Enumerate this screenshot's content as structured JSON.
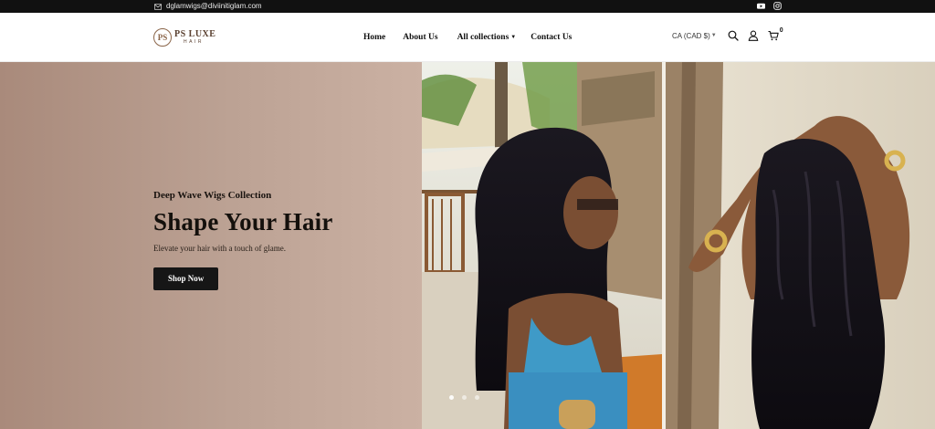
{
  "topbar": {
    "email": "dglamwigs@diviinitiglam.com",
    "social": [
      "youtube-icon",
      "instagram-icon"
    ]
  },
  "header": {
    "logo": {
      "mark": "PS",
      "brand": "PS LUXE",
      "sub": "HAIR"
    },
    "nav": [
      {
        "label": "Home"
      },
      {
        "label": "About Us"
      },
      {
        "label": "All collections",
        "has_dropdown": true
      },
      {
        "label": "Contact Us"
      }
    ],
    "currency": "CA (CAD $)",
    "cart_count": "0",
    "icons": [
      "search-icon",
      "account-icon",
      "cart-icon"
    ]
  },
  "hero": {
    "kicker": "Deep Wave Wigs Collection",
    "headline": "Shape Your Hair",
    "tagline": "Elevate your hair with a touch of glame.",
    "cta_label": "Shop Now",
    "slide_count": 3,
    "active_slide": 1
  },
  "colors": {
    "topbar_bg": "#111111",
    "hero_gradient_start": "#a98a7b",
    "hero_gradient_end": "#cbb1a3",
    "cta_bg": "#161616"
  }
}
